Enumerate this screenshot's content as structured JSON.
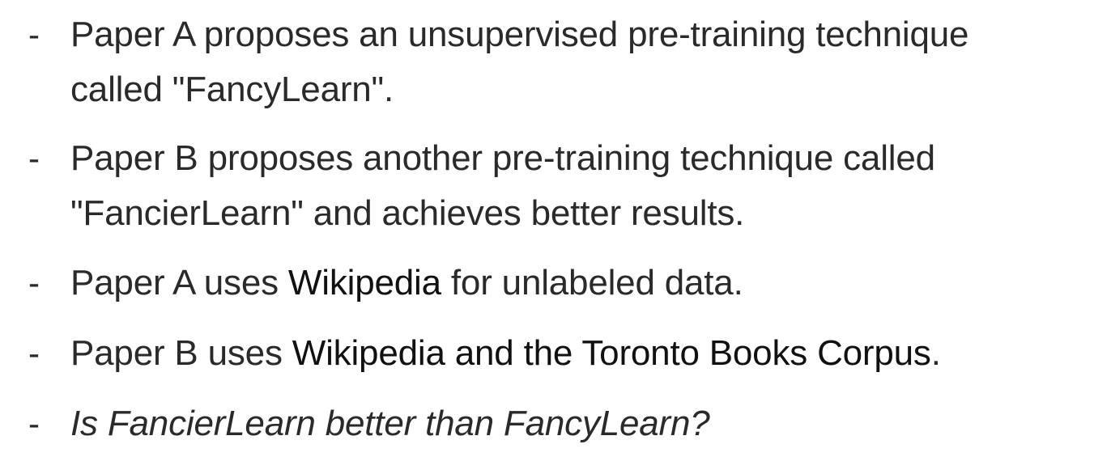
{
  "bullets": {
    "marker": "-",
    "items": [
      {
        "line1": "Paper A proposes an unsupervised pre-training technique",
        "line2": "called \"FancyLearn\"."
      },
      {
        "line1": "Paper B proposes another pre-training technique called",
        "line2": "\"FancierLearn\" and achieves better results."
      },
      {
        "prefix": "Paper A uses ",
        "emphasis": "Wikipedia",
        "suffix": " for unlabeled data."
      },
      {
        "prefix": "Paper B uses ",
        "emphasis": "Wikipedia and the Toronto Books Corpus",
        "suffix": "."
      },
      {
        "question": "Is FancierLearn better than FancyLearn?"
      }
    ]
  }
}
